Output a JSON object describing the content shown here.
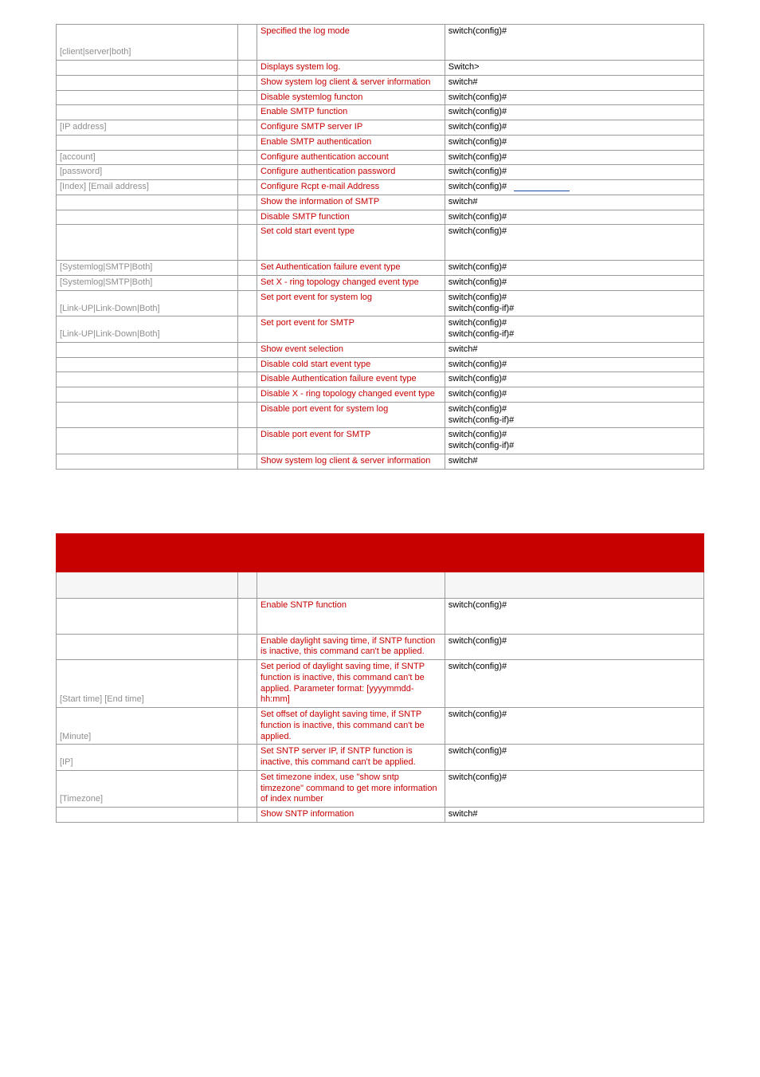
{
  "table1": {
    "rows": [
      {
        "cmd": "[client|server|both]",
        "desc": "Specified the log mode",
        "def": "switch(config)#",
        "tall": true
      },
      {
        "cmd": "",
        "desc": "Displays system log.",
        "def": "Switch>"
      },
      {
        "cmd": "",
        "desc": "Show system log client & server information",
        "def": "switch#"
      },
      {
        "cmd": "",
        "desc": "Disable systemlog functon",
        "def": "switch(config)#"
      },
      {
        "cmd": "",
        "desc": "Enable SMTP function",
        "def": "switch(config)#"
      },
      {
        "cmd": "[IP address]",
        "desc": "Configure SMTP server IP",
        "def": "switch(config)#"
      },
      {
        "cmd": "",
        "desc": "Enable SMTP authentication",
        "def": "switch(config)#"
      },
      {
        "cmd": "[account]",
        "desc": "Configure authentication account",
        "def": "switch(config)#"
      },
      {
        "cmd": "[password]",
        "desc": "Configure authentication password",
        "def": "switch(config)#"
      },
      {
        "cmd": "[Index] [Email address]",
        "desc": "Configure Rcpt e-mail Address",
        "def": "switch(config)#",
        "mark": true
      },
      {
        "cmd": "",
        "desc": "Show the information of SMTP",
        "def": "switch#"
      },
      {
        "cmd": "",
        "desc": "Disable SMTP function",
        "def": "switch(config)#"
      },
      {
        "cmd": "",
        "desc": "Set cold start event type",
        "def": "switch(config)#",
        "tall": true
      },
      {
        "cmd": "[Systemlog|SMTP|Both]",
        "desc": "Set Authentication failure event type",
        "def": "switch(config)#"
      },
      {
        "cmd": "[Systemlog|SMTP|Both]",
        "desc": "Set X -  ring topology changed event type",
        "def": "switch(config)#"
      },
      {
        "cmd": "[Link-UP|Link-Down|Both]",
        "desc": "Set port event for system log",
        "def": "switch(config)#\nswitch(config-if)#"
      },
      {
        "cmd": "[Link-UP|Link-Down|Both]",
        "desc": "Set port event for SMTP",
        "def": "switch(config)#\nswitch(config-if)#"
      },
      {
        "cmd": "",
        "desc": "Show event selection",
        "def": "switch#"
      },
      {
        "cmd": "",
        "desc": "Disable cold start event type",
        "def": "switch(config)#"
      },
      {
        "cmd": "",
        "desc": "Disable Authentication failure event type",
        "def": "switch(config)#"
      },
      {
        "cmd": "",
        "desc": "Disable X -  ring topology changed event type",
        "def": "switch(config)#"
      },
      {
        "cmd": "",
        "desc": "Disable port event for system log",
        "def": "switch(config)#\nswitch(config-if)#"
      },
      {
        "cmd": "",
        "desc": "Disable port event for SMTP",
        "def": "switch(config)#\nswitch(config-if)#"
      },
      {
        "cmd": "",
        "desc": "Show system log client & server information",
        "def": "switch#"
      }
    ]
  },
  "table2": {
    "rows": [
      {
        "cmd": "",
        "desc": "Enable SNTP function",
        "def": "switch(config)#",
        "tall": true
      },
      {
        "cmd": "",
        "desc": "Enable daylight saving time, if SNTP function is inactive, this command can't be applied.",
        "def": "switch(config)#"
      },
      {
        "cmd": "[Start time] [End time]",
        "desc": "Set period of daylight saving time, if SNTP function is inactive, this command can't be applied.\nParameter format:\n[yyyymmdd-hh:mm]",
        "def": "switch(config)#"
      },
      {
        "cmd": "[Minute]",
        "desc": "Set offset of daylight saving time, if SNTP function is inactive, this command can't be applied.",
        "def": "switch(config)#"
      },
      {
        "cmd": "[IP]",
        "desc": "Set SNTP server IP, if SNTP function is inactive, this command can't be applied.",
        "def": "switch(config)#"
      },
      {
        "cmd": "[Timezone]",
        "desc": "Set timezone index, use \"show sntp timzezone\" command to get more information of index number",
        "def": "switch(config)#"
      },
      {
        "cmd": "",
        "desc": "Show SNTP information",
        "def": "switch#"
      }
    ]
  }
}
